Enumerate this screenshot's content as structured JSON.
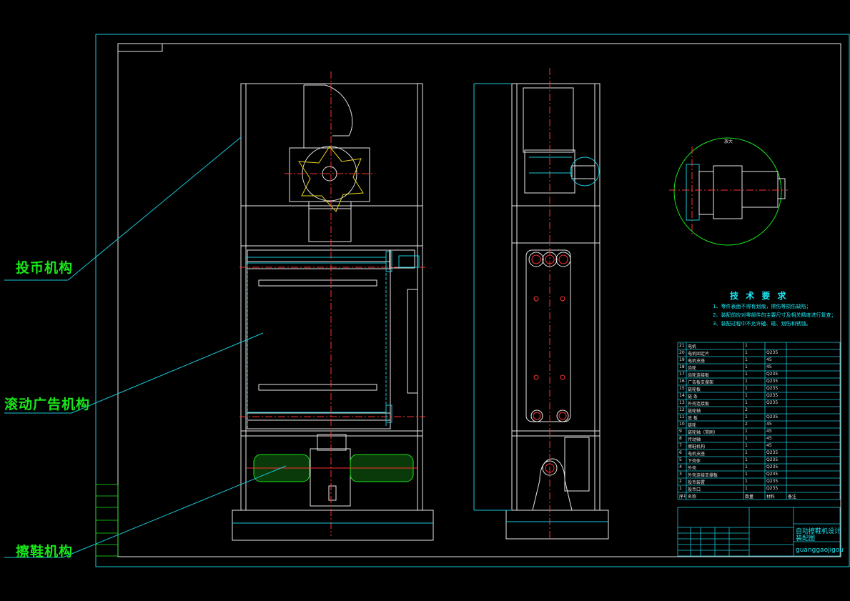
{
  "callouts": {
    "coin": "投币机构",
    "scroll_ad": "滚动广告机构",
    "shoe_wipe": "擦鞋机构"
  },
  "detail": {
    "title": "放大"
  },
  "tech_requirements": {
    "title": "技 术 要 求",
    "items": [
      "1、零件表面不得有划痕，擦伤等损伤缺陷；",
      "2、装配前应对零部件的主要尺寸及相关精度进行复查；",
      "3、装配过程中不允许磕、碰、划伤和锈蚀。"
    ]
  },
  "bom": {
    "rows": [
      {
        "no": "21",
        "name": "电机",
        "qty": "1",
        "mat": ""
      },
      {
        "no": "20",
        "name": "电机固定片",
        "qty": "1",
        "mat": "Q235"
      },
      {
        "no": "19",
        "name": "电机支座",
        "qty": "1",
        "mat": "45"
      },
      {
        "no": "18",
        "name": "齿轮",
        "qty": "1",
        "mat": "45"
      },
      {
        "no": "17",
        "name": "齿轮连接板",
        "qty": "1",
        "mat": "Q235"
      },
      {
        "no": "16",
        "name": "广告板支撑架",
        "qty": "1",
        "mat": "Q235"
      },
      {
        "no": "15",
        "name": "链轮板",
        "qty": "1",
        "mat": "Q235"
      },
      {
        "no": "14",
        "name": "链 条",
        "qty": "1",
        "mat": "Q235"
      },
      {
        "no": "13",
        "name": "外壳连接板",
        "qty": "1",
        "mat": "Q235"
      },
      {
        "no": "12",
        "name": "链轮轴",
        "qty": "2",
        "mat": ""
      },
      {
        "no": "11",
        "name": "底 板",
        "qty": "1",
        "mat": "Q235"
      },
      {
        "no": "10",
        "name": "链轮",
        "qty": "2",
        "mat": "45"
      },
      {
        "no": "9",
        "name": "链轮轴（带刷）",
        "qty": "1",
        "mat": "45"
      },
      {
        "no": "8",
        "name": "传动轴",
        "qty": "1",
        "mat": "45"
      },
      {
        "no": "7",
        "name": "擦鞋机构",
        "qty": "1",
        "mat": "45"
      },
      {
        "no": "6",
        "name": "电机支座",
        "qty": "1",
        "mat": "Q235"
      },
      {
        "no": "5",
        "name": "下壳体",
        "qty": "1",
        "mat": "Q235"
      },
      {
        "no": "4",
        "name": "外壳",
        "qty": "1",
        "mat": "Q235"
      },
      {
        "no": "3",
        "name": "外壳连接支撑板",
        "qty": "1",
        "mat": "Q235"
      },
      {
        "no": "2",
        "name": "投币装置",
        "qty": "1",
        "mat": "Q235"
      },
      {
        "no": "1",
        "name": "投币口",
        "qty": "1",
        "mat": "Q235"
      }
    ],
    "header": [
      "序号",
      "名称",
      "数量",
      "材料",
      "备注"
    ]
  },
  "title_block": {
    "project": "自动擦鞋机设计",
    "drawing": "装配图",
    "company": "guanggaojigou"
  }
}
